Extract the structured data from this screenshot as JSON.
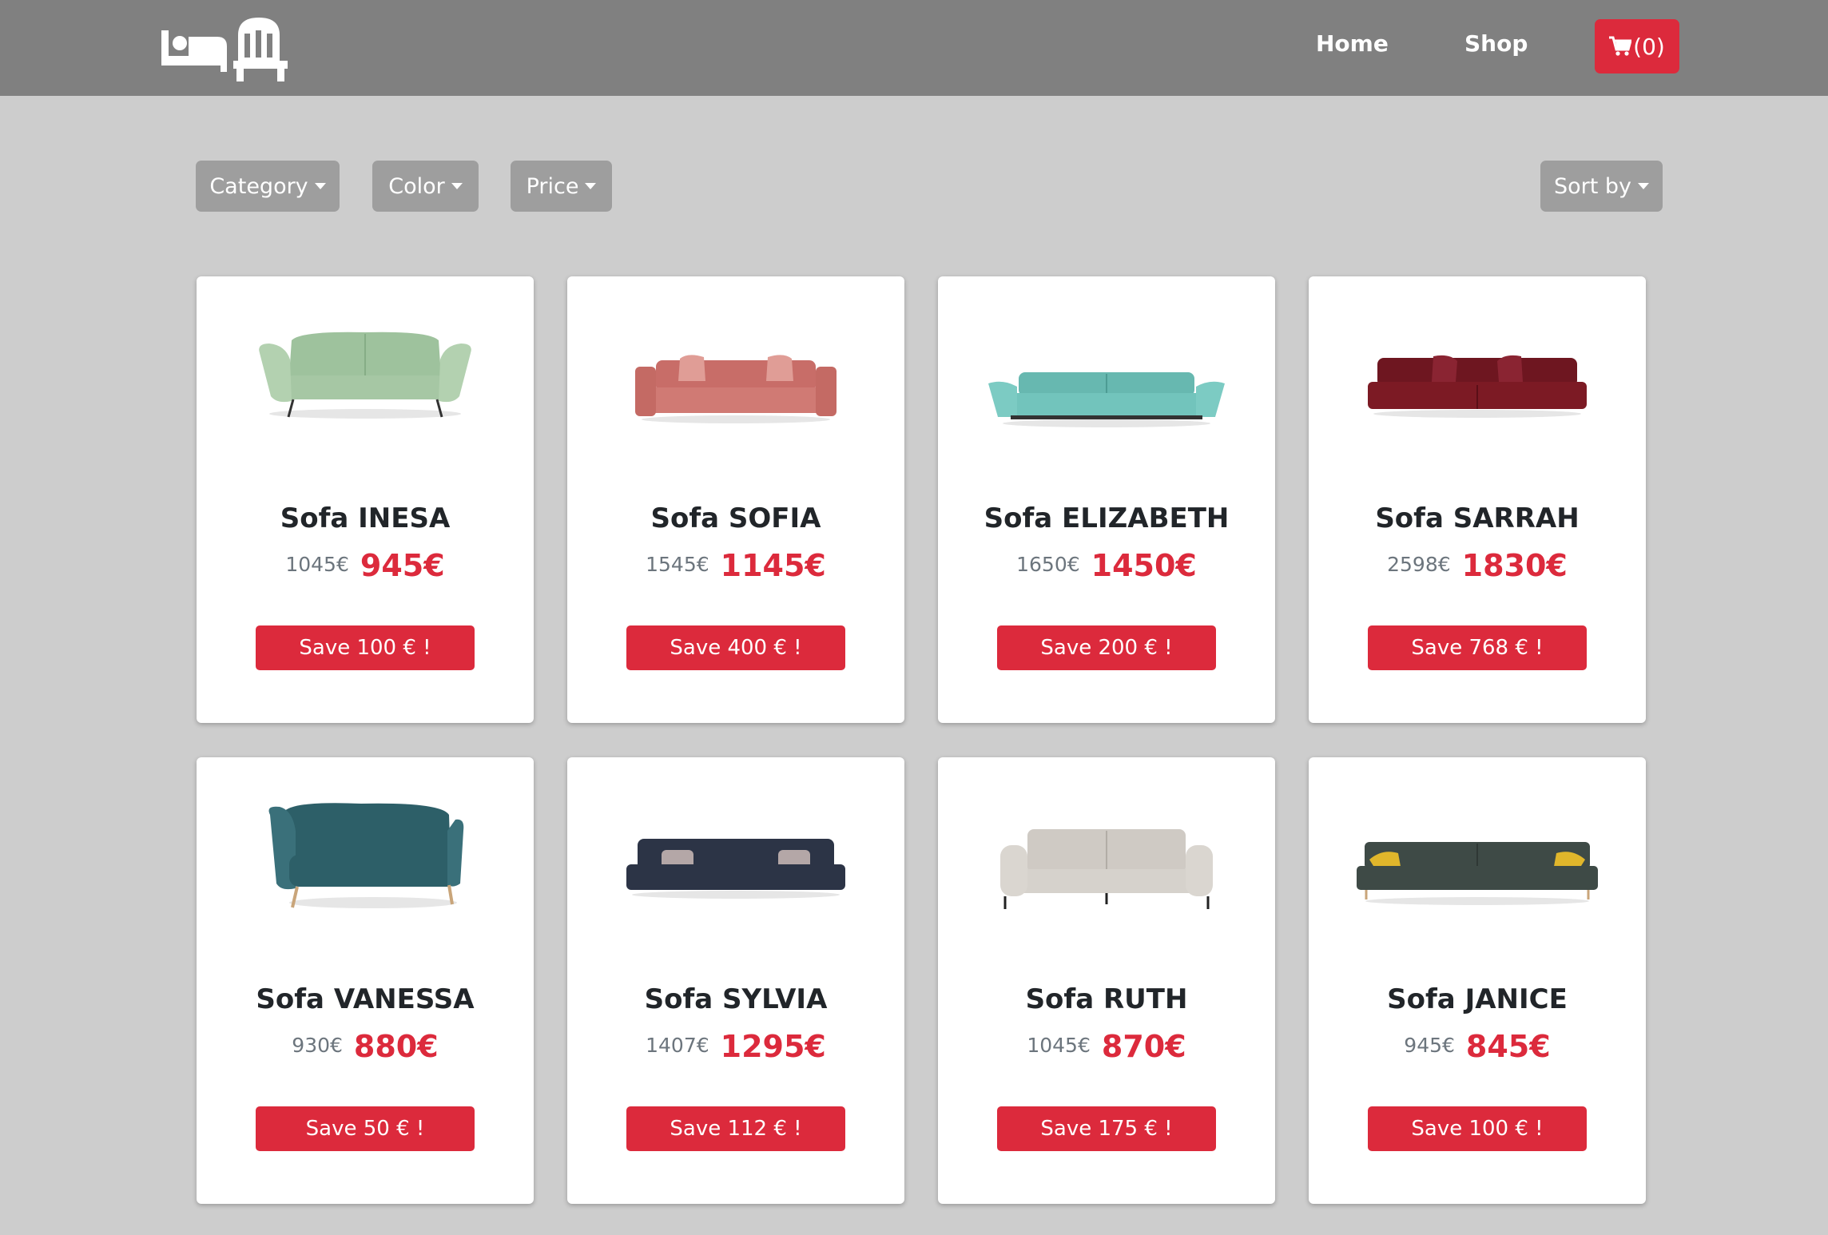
{
  "nav": {
    "home_label": "Home",
    "shop_label": "Shop",
    "cart_label": "(0)"
  },
  "filters": {
    "category_label": "Category",
    "color_label": "Color",
    "price_label": "Price",
    "sort_label": "Sort by"
  },
  "colors": {
    "navbar": "#808080",
    "background": "#cdcdcd",
    "accent_red": "#dc2a3c",
    "filter_button": "#9e9e9e"
  },
  "products": [
    {
      "title": "Sofa INESA",
      "old_price": "1045€",
      "price": "945€",
      "save_label": "Save 100 € !",
      "sofa_color": "#a6c7a4"
    },
    {
      "title": "Sofa SOFIA",
      "old_price": "1545€",
      "price": "1145€",
      "save_label": "Save 400 € !",
      "sofa_color": "#d07a74"
    },
    {
      "title": "Sofa ELIZABETH",
      "old_price": "1650€",
      "price": "1450€",
      "save_label": "Save 200 € !",
      "sofa_color": "#72c4bc"
    },
    {
      "title": "Sofa SARRAH",
      "old_price": "2598€",
      "price": "1830€",
      "save_label": "Save 768 € !",
      "sofa_color": "#7c1a24"
    },
    {
      "title": "Sofa VANESSA",
      "old_price": "930€",
      "price": "880€",
      "save_label": "Save 50 € !",
      "sofa_color": "#2d5f68"
    },
    {
      "title": "Sofa SYLVIA",
      "old_price": "1407€",
      "price": "1295€",
      "save_label": "Save 112 € !",
      "sofa_color": "#2c3446"
    },
    {
      "title": "Sofa RUTH",
      "old_price": "1045€",
      "price": "870€",
      "save_label": "Save 175 € !",
      "sofa_color": "#d6d2cc"
    },
    {
      "title": "Sofa JANICE",
      "old_price": "945€",
      "price": "845€",
      "save_label": "Save 100 € !",
      "sofa_color": "#3e4a46"
    }
  ]
}
